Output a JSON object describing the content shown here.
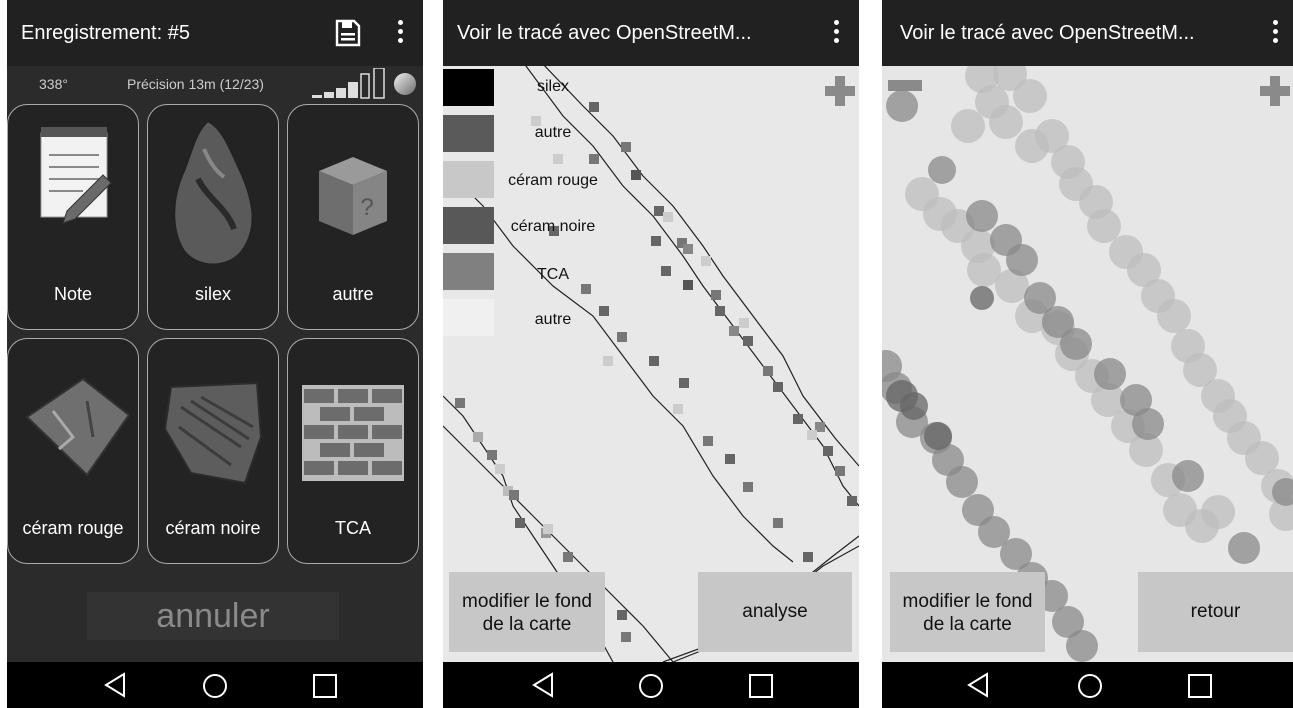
{
  "screen1": {
    "title": "Enregistrement: #5",
    "heading": "338°",
    "precision": "Précision 13m (12/23)",
    "tiles": [
      {
        "label": "Note"
      },
      {
        "label": "silex"
      },
      {
        "label": "autre"
      },
      {
        "label": "céram rouge"
      },
      {
        "label": "céram noire"
      },
      {
        "label": "TCA"
      }
    ],
    "cancel_label": "annuler"
  },
  "screen2": {
    "title": "Voir le tracé avec OpenStreetM...",
    "legend": [
      {
        "label": "silex",
        "color": "#000000"
      },
      {
        "label": "autre",
        "color": "#5a5a5a"
      },
      {
        "label": "céram rouge",
        "color": "#c8c8c8"
      },
      {
        "label": "céram noire",
        "color": "#585858"
      },
      {
        "label": "TCA",
        "color": "#808080"
      },
      {
        "label": "autre",
        "color": "#f0f0f0"
      }
    ],
    "left_button": "modifier le fond de la carte",
    "right_button": "analyse"
  },
  "screen3": {
    "title": "Voir le tracé avec OpenStreetM...",
    "left_button": "modifier le fond de la carte",
    "right_button": "retour"
  }
}
